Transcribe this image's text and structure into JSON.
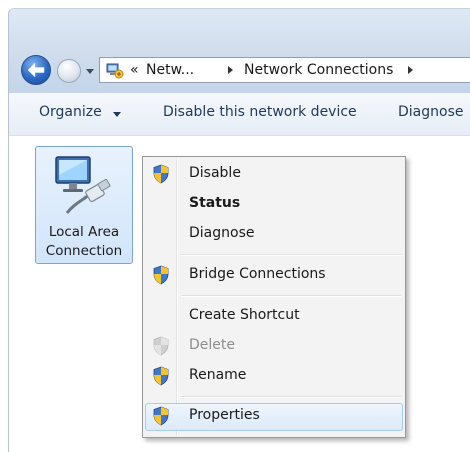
{
  "address_bar": {
    "crumbs": [
      "Netw...",
      "Network Connections"
    ],
    "overflow_glyph": "«"
  },
  "toolbar": {
    "organize_label": "Organize",
    "disable_label": "Disable this network device",
    "diagnose_label": "Diagnose"
  },
  "items": [
    {
      "label_line1": "Local Area",
      "label_line2": "Connection",
      "icon": "network-adapter-icon",
      "selected": true
    }
  ],
  "context_menu": {
    "items": [
      {
        "label": "Disable",
        "icon": "uac-shield-icon",
        "style": "normal"
      },
      {
        "label": "Status",
        "icon": "",
        "style": "bold"
      },
      {
        "label": "Diagnose",
        "icon": "",
        "style": "normal"
      },
      {
        "label": "Bridge Connections",
        "icon": "uac-shield-icon",
        "style": "normal"
      },
      {
        "label": "Create Shortcut",
        "icon": "",
        "style": "normal"
      },
      {
        "label": "Delete",
        "icon": "uac-shield-icon",
        "style": "disabled"
      },
      {
        "label": "Rename",
        "icon": "uac-shield-icon",
        "style": "normal"
      },
      {
        "label": "Properties",
        "icon": "uac-shield-icon",
        "style": "highlighted"
      }
    ]
  },
  "colors": {
    "menu_background": "#f3f3f3",
    "selection_fill": "#d1e5fb",
    "toolbar_text": "#1e395b",
    "disabled_text": "#8d8d8d"
  }
}
